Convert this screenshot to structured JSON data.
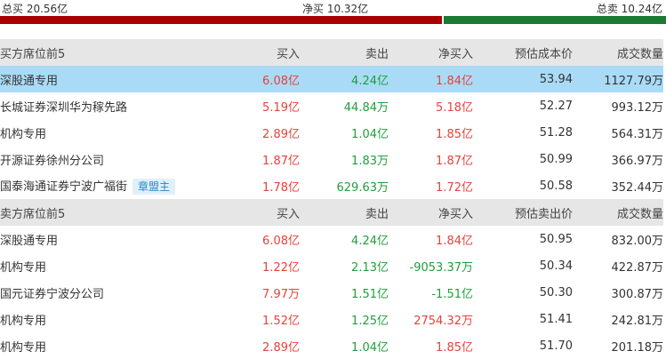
{
  "summary": {
    "total_buy": "总买 20.56亿",
    "net_buy": "净买 10.32亿",
    "total_sell": "总卖 10.24亿",
    "buy_ratio": 0.664,
    "buy_color": "#a80000",
    "sell_color": "#1a7a32"
  },
  "buy_header": {
    "title": "买方席位前5",
    "buy": "买入",
    "sell": "卖出",
    "net": "净买入",
    "cost": "预估成本价",
    "volume": "成交数量"
  },
  "buy_rows": [
    {
      "name": "深股通专用",
      "tag": "",
      "buy": "6.08亿",
      "sell": "4.24亿",
      "net": "1.84亿",
      "net_color": "red",
      "cost": "53.94",
      "volume": "1127.79万",
      "highlight": true
    },
    {
      "name": "长城证券深圳华为稼先路",
      "tag": "",
      "buy": "5.19亿",
      "sell": "44.84万",
      "net": "5.18亿",
      "net_color": "red",
      "cost": "52.27",
      "volume": "993.12万",
      "highlight": false
    },
    {
      "name": "机构专用",
      "tag": "",
      "buy": "2.89亿",
      "sell": "1.04亿",
      "net": "1.85亿",
      "net_color": "red",
      "cost": "51.28",
      "volume": "564.31万",
      "highlight": false
    },
    {
      "name": "开源证券徐州分公司",
      "tag": "",
      "buy": "1.87亿",
      "sell": "1.83万",
      "net": "1.87亿",
      "net_color": "red",
      "cost": "50.99",
      "volume": "366.97万",
      "highlight": false
    },
    {
      "name": "国泰海通证券宁波广福街",
      "tag": "章盟主",
      "buy": "1.78亿",
      "sell": "629.63万",
      "net": "1.72亿",
      "net_color": "red",
      "cost": "50.58",
      "volume": "352.44万",
      "highlight": false
    }
  ],
  "sell_header": {
    "title": "卖方席位前5",
    "buy": "买入",
    "sell": "卖出",
    "net": "净买入",
    "cost": "预估卖出价",
    "volume": "成交数量"
  },
  "sell_rows": [
    {
      "name": "深股通专用",
      "tag": "",
      "buy": "6.08亿",
      "sell": "4.24亿",
      "net": "1.84亿",
      "net_color": "red",
      "cost": "50.95",
      "volume": "832.00万",
      "highlight": false
    },
    {
      "name": "机构专用",
      "tag": "",
      "buy": "1.22亿",
      "sell": "2.13亿",
      "net": "-9053.37万",
      "net_color": "green",
      "cost": "50.34",
      "volume": "422.87万",
      "highlight": false
    },
    {
      "name": "国元证券宁波分公司",
      "tag": "",
      "buy": "7.97万",
      "sell": "1.51亿",
      "net": "-1.51亿",
      "net_color": "green",
      "cost": "50.30",
      "volume": "300.87万",
      "highlight": false
    },
    {
      "name": "机构专用",
      "tag": "",
      "buy": "1.52亿",
      "sell": "1.25亿",
      "net": "2754.32万",
      "net_color": "red",
      "cost": "51.41",
      "volume": "242.81万",
      "highlight": false
    },
    {
      "name": "机构专用",
      "tag": "",
      "buy": "2.89亿",
      "sell": "1.04亿",
      "net": "1.85亿",
      "net_color": "red",
      "cost": "51.70",
      "volume": "201.18万",
      "highlight": false
    }
  ]
}
